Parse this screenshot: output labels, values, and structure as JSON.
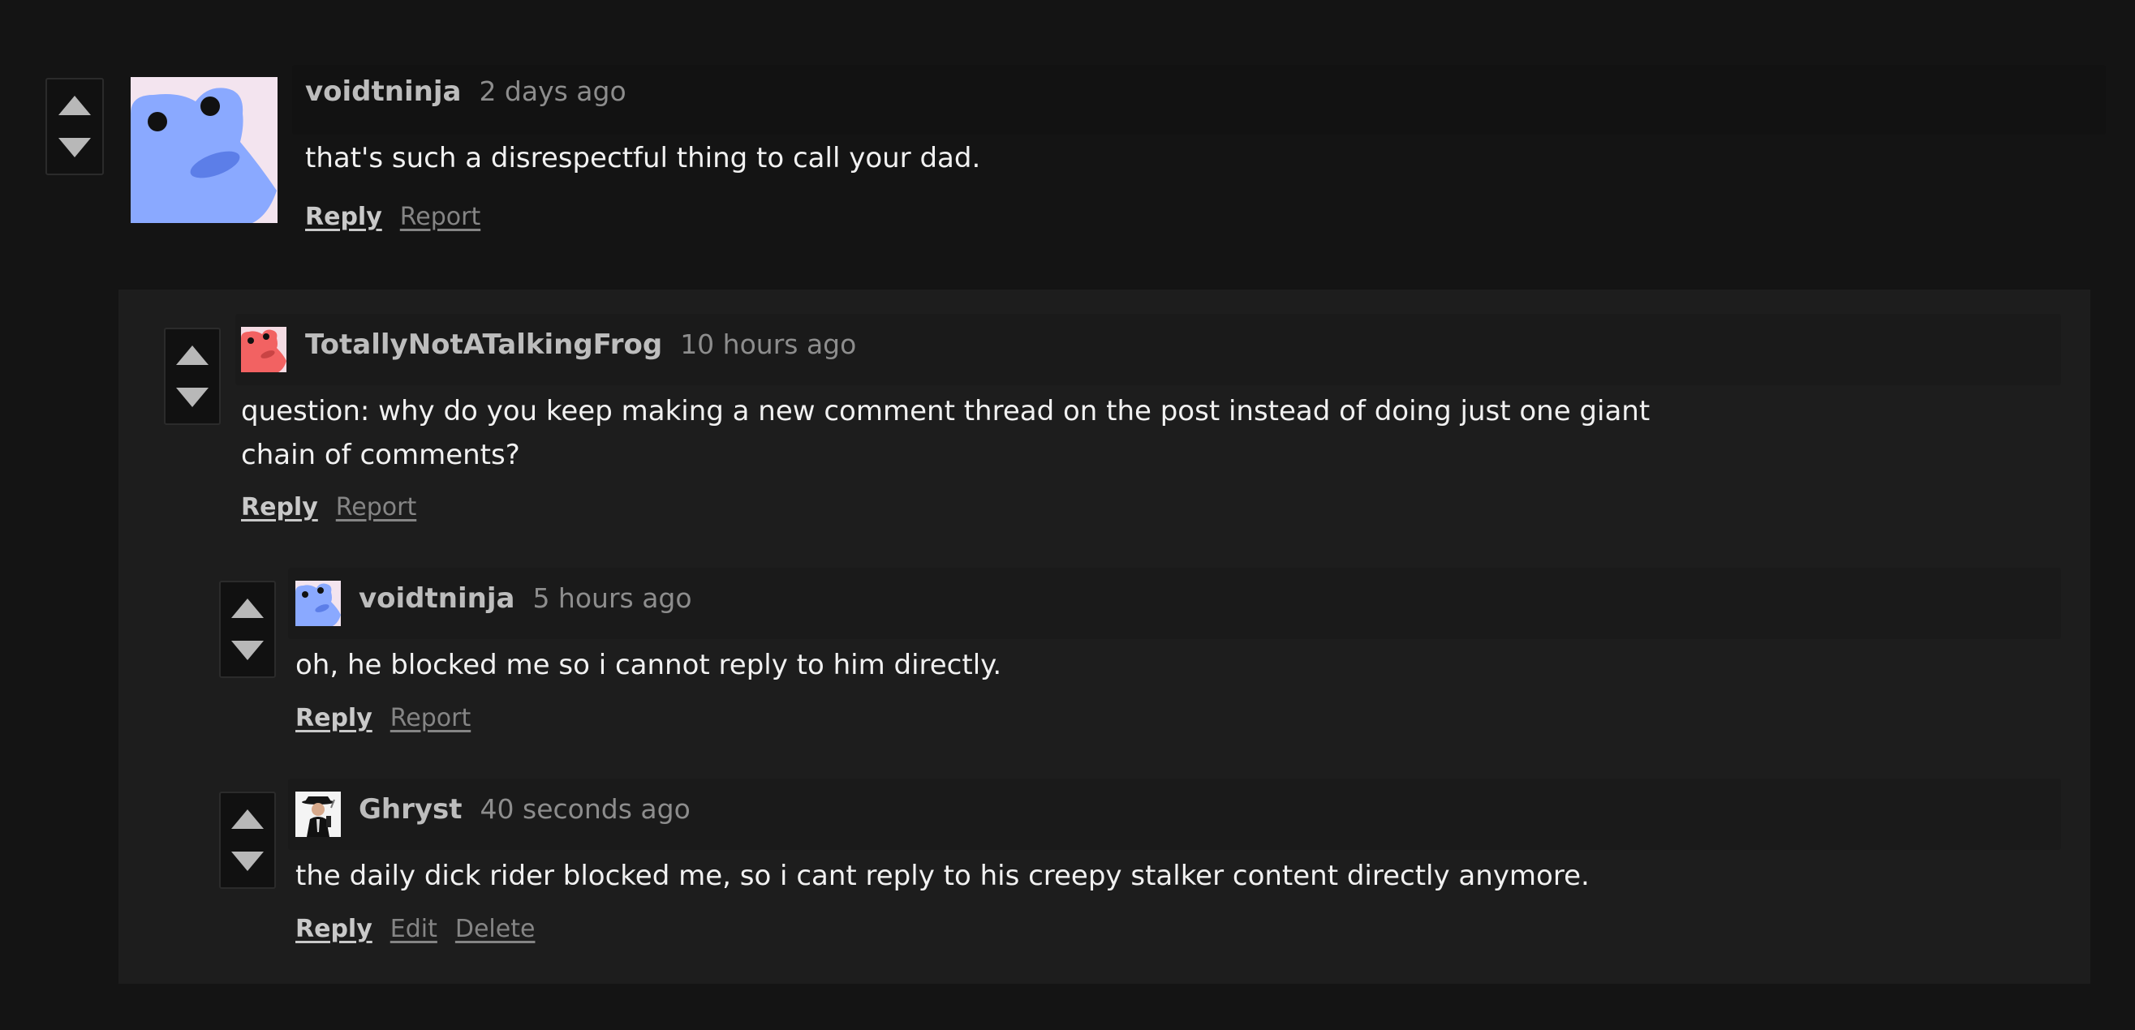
{
  "colors": {
    "background": "#141414",
    "thread_background": "#1d1d1d",
    "username": "#bdbdbd",
    "timestamp": "#8d8d8d",
    "body_text": "#f1f1f1",
    "avatar_blue": "#8aa9ff",
    "avatar_red": "#f26262"
  },
  "comments": [
    {
      "username": "voidtninja",
      "time": "2 days ago",
      "text": "that's such a disrespectful thing to call your dad.",
      "avatar": "blue-frog-icon",
      "actions": [
        "Reply",
        "Report"
      ]
    },
    {
      "username": "TotallyNotATalkingFrog",
      "time": "10 hours ago",
      "text": "question: why do you keep making a new comment thread on the post instead of doing just one giant chain of comments?",
      "avatar": "red-frog-icon",
      "actions": [
        "Reply",
        "Report"
      ]
    },
    {
      "username": "voidtninja",
      "time": "5 hours ago",
      "text": "oh, he blocked me so i cannot reply to him directly.",
      "avatar": "blue-frog-icon",
      "actions": [
        "Reply",
        "Report"
      ]
    },
    {
      "username": "Ghryst",
      "time": "40 seconds ago",
      "text": "the daily dick rider blocked me, so i cant reply to his creepy stalker content directly anymore.",
      "avatar": "suited-man-icon",
      "actions": [
        "Reply",
        "Edit",
        "Delete"
      ]
    }
  ]
}
